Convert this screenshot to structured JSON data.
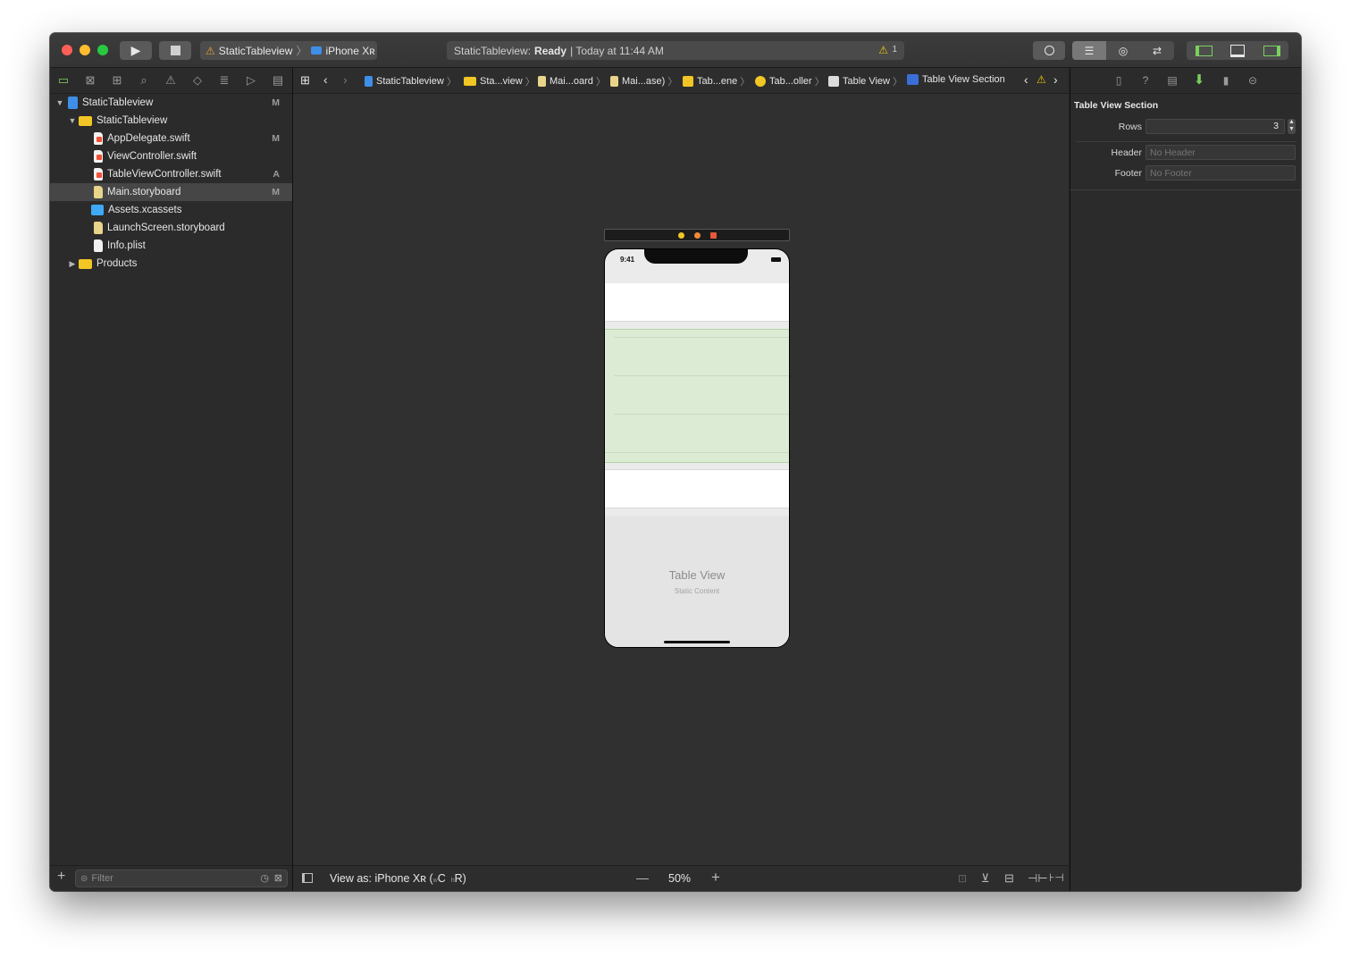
{
  "toolbar": {
    "scheme_name": "StaticTableview",
    "destination": "iPhone Xʀ",
    "status_project": "StaticTableview:",
    "status_state": "Ready",
    "status_time": "| Today at 11:44 AM",
    "warning_count": "1"
  },
  "navigator": {
    "items": [
      {
        "label": "StaticTableview",
        "badge": "M"
      },
      {
        "label": "StaticTableview",
        "badge": ""
      },
      {
        "label": "AppDelegate.swift",
        "badge": "M"
      },
      {
        "label": "ViewController.swift",
        "badge": ""
      },
      {
        "label": "TableViewController.swift",
        "badge": "A"
      },
      {
        "label": "Main.storyboard",
        "badge": "M"
      },
      {
        "label": "Assets.xcassets",
        "badge": ""
      },
      {
        "label": "LaunchScreen.storyboard",
        "badge": ""
      },
      {
        "label": "Info.plist",
        "badge": ""
      },
      {
        "label": "Products",
        "badge": ""
      }
    ],
    "filter_placeholder": "Filter"
  },
  "jumpbar": {
    "crumbs": [
      "StaticTableview",
      "Sta...view",
      "Mai...oard",
      "Mai...ase)",
      "Tab...ene",
      "Tab...oller",
      "Table View",
      "Table View Section"
    ]
  },
  "canvas": {
    "status_time": "9:41",
    "placeholder_title": "Table View",
    "placeholder_subtitle": "Static Content",
    "view_as": "View as: iPhone Xʀ (",
    "size_w": "w",
    "size_c": "C",
    "size_h": "h",
    "size_r": "R)",
    "zoom": "50%",
    "zoom_out": "—",
    "zoom_in": "+"
  },
  "inspector": {
    "section_title": "Table View Section",
    "rows_label": "Rows",
    "rows_value": "3",
    "header_label": "Header",
    "header_placeholder": "No Header",
    "footer_label": "Footer",
    "footer_placeholder": "No Footer"
  },
  "colors": {
    "close": "#fe5f57",
    "minimize": "#febc2e",
    "zoom": "#28c840",
    "selection_green": "#dcecd4",
    "warning": "#f5c400"
  }
}
